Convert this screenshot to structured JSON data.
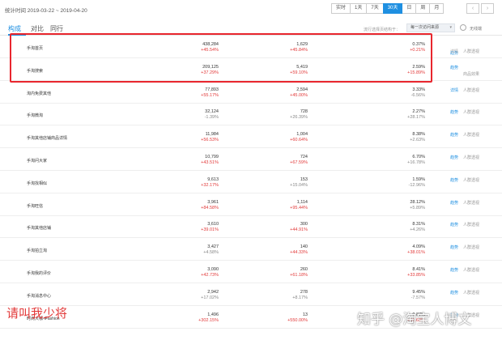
{
  "header": {
    "date_range": "统计时间 2019-03-22 ~ 2019-04-20",
    "periods": [
      "实时",
      "1天",
      "7天",
      "30天",
      "日",
      "周",
      "月"
    ],
    "active_period": "30天",
    "nav_prev": "‹",
    "nav_next": "›"
  },
  "tabs": {
    "items": [
      "构成",
      "对比",
      "同行"
    ],
    "active": "构成",
    "source_label": "流行选择页结构于：",
    "source_select": "每一次访问来源",
    "compare_label": "无线端"
  },
  "rows": [
    {
      "name": "手淘首页",
      "m1": "438,284",
      "m1p": "+45.54%",
      "m1d": "up",
      "m2": "1,629",
      "m2p": "+45.84%",
      "m2d": "up",
      "m3": "0.37%",
      "m3p": "+0.21%",
      "m3d": "up",
      "a1": "趋势",
      "a2": "人群透视"
    },
    {
      "name": "手淘搜索",
      "m1": "209,125",
      "m1p": "+37.29%",
      "m1d": "up",
      "m2": "5,419",
      "m2p": "+59.10%",
      "m2d": "up",
      "m3": "2.59%",
      "m3p": "+15.89%",
      "m3d": "up",
      "a1": "趋势",
      "a2": "商品效果"
    },
    {
      "name": "淘内免费其他",
      "m1": "77,893",
      "m1p": "+55.17%",
      "m1d": "up",
      "m2": "2,594",
      "m2p": "+45.00%",
      "m2d": "up",
      "m3": "3.33%",
      "m3p": "-6.56%",
      "m3d": "down",
      "a1": "详情",
      "a2": "人群透视"
    },
    {
      "name": "手淘微淘",
      "m1": "32,124",
      "m1p": "-1.39%",
      "m1d": "down",
      "m2": "728",
      "m2p": "+26.39%",
      "m2d": "down",
      "m3": "2.27%",
      "m3p": "+28.17%",
      "m3d": "down",
      "a1": "趋势",
      "a2": "人群透视"
    },
    {
      "name": "手淘其他店铺商品详情",
      "m1": "11,984",
      "m1p": "+56.53%",
      "m1d": "up",
      "m2": "1,004",
      "m2p": "+60.64%",
      "m2d": "up",
      "m3": "8.38%",
      "m3p": "+2.63%",
      "m3d": "down",
      "a1": "趋势",
      "a2": "人群透视"
    },
    {
      "name": "手淘问大家",
      "m1": "10,799",
      "m1p": "+43.51%",
      "m1d": "up",
      "m2": "724",
      "m2p": "+67.59%",
      "m2d": "up",
      "m3": "6.70%",
      "m3p": "+16.78%",
      "m3d": "down",
      "a1": "趋势",
      "a2": "人群透视"
    },
    {
      "name": "手淘找相似",
      "m1": "9,613",
      "m1p": "+32.17%",
      "m1d": "up",
      "m2": "153",
      "m2p": "+15.04%",
      "m2d": "down",
      "m3": "1.59%",
      "m3p": "-12.96%",
      "m3d": "down",
      "a1": "趋势",
      "a2": "人群透视"
    },
    {
      "name": "手淘旺信",
      "m1": "3,961",
      "m1p": "+84.58%",
      "m1d": "up",
      "m2": "1,114",
      "m2p": "+95.44%",
      "m2d": "up",
      "m3": "28.12%",
      "m3p": "+5.89%",
      "m3d": "down",
      "a1": "趋势",
      "a2": "人群透视"
    },
    {
      "name": "手淘其他店铺",
      "m1": "3,610",
      "m1p": "+39.01%",
      "m1d": "up",
      "m2": "300",
      "m2p": "+44.91%",
      "m2d": "up",
      "m3": "8.31%",
      "m3p": "+4.26%",
      "m3d": "down",
      "a1": "趋势",
      "a2": "人群透视"
    },
    {
      "name": "手淘拍立淘",
      "m1": "3,427",
      "m1p": "+4.58%",
      "m1d": "down",
      "m2": "140",
      "m2p": "+44.33%",
      "m2d": "up",
      "m3": "4.09%",
      "m3p": "+38.01%",
      "m3d": "up",
      "a1": "趋势",
      "a2": "人群透视"
    },
    {
      "name": "手淘我的评价",
      "m1": "3,090",
      "m1p": "+42.73%",
      "m1d": "up",
      "m2": "260",
      "m2p": "+61.18%",
      "m2d": "up",
      "m3": "8.41%",
      "m3p": "+33.85%",
      "m3d": "up",
      "a1": "趋势",
      "a2": "人群透视"
    },
    {
      "name": "手淘消息中心",
      "m1": "2,942",
      "m1p": "+17.02%",
      "m1d": "down",
      "m2": "278",
      "m2p": "+8.17%",
      "m2d": "down",
      "m3": "9.45%",
      "m3p": "-7.57%",
      "m3d": "down",
      "a1": "趋势",
      "a2": "人群透视"
    },
    {
      "name": "时尚大咖-iFashion",
      "m1": "1,496",
      "m1p": "+302.15%",
      "m1d": "up",
      "m2": "13",
      "m2p": "+550.00%",
      "m2d": "up",
      "m3": "0.87%",
      "m3p": "+61.63%",
      "m3d": "up",
      "a1": "趋势",
      "a2": "人群透视"
    }
  ],
  "top_actions": {
    "a1": "详情",
    "a2": "人群透视",
    "a3": "商品效果"
  },
  "watermarks": {
    "left": "请叫我少将",
    "right": "知乎 @淘宝人博文"
  },
  "colors": {
    "accent": "#1e8fe1",
    "up": "#e23a3a",
    "highlight": "#e8262e"
  }
}
